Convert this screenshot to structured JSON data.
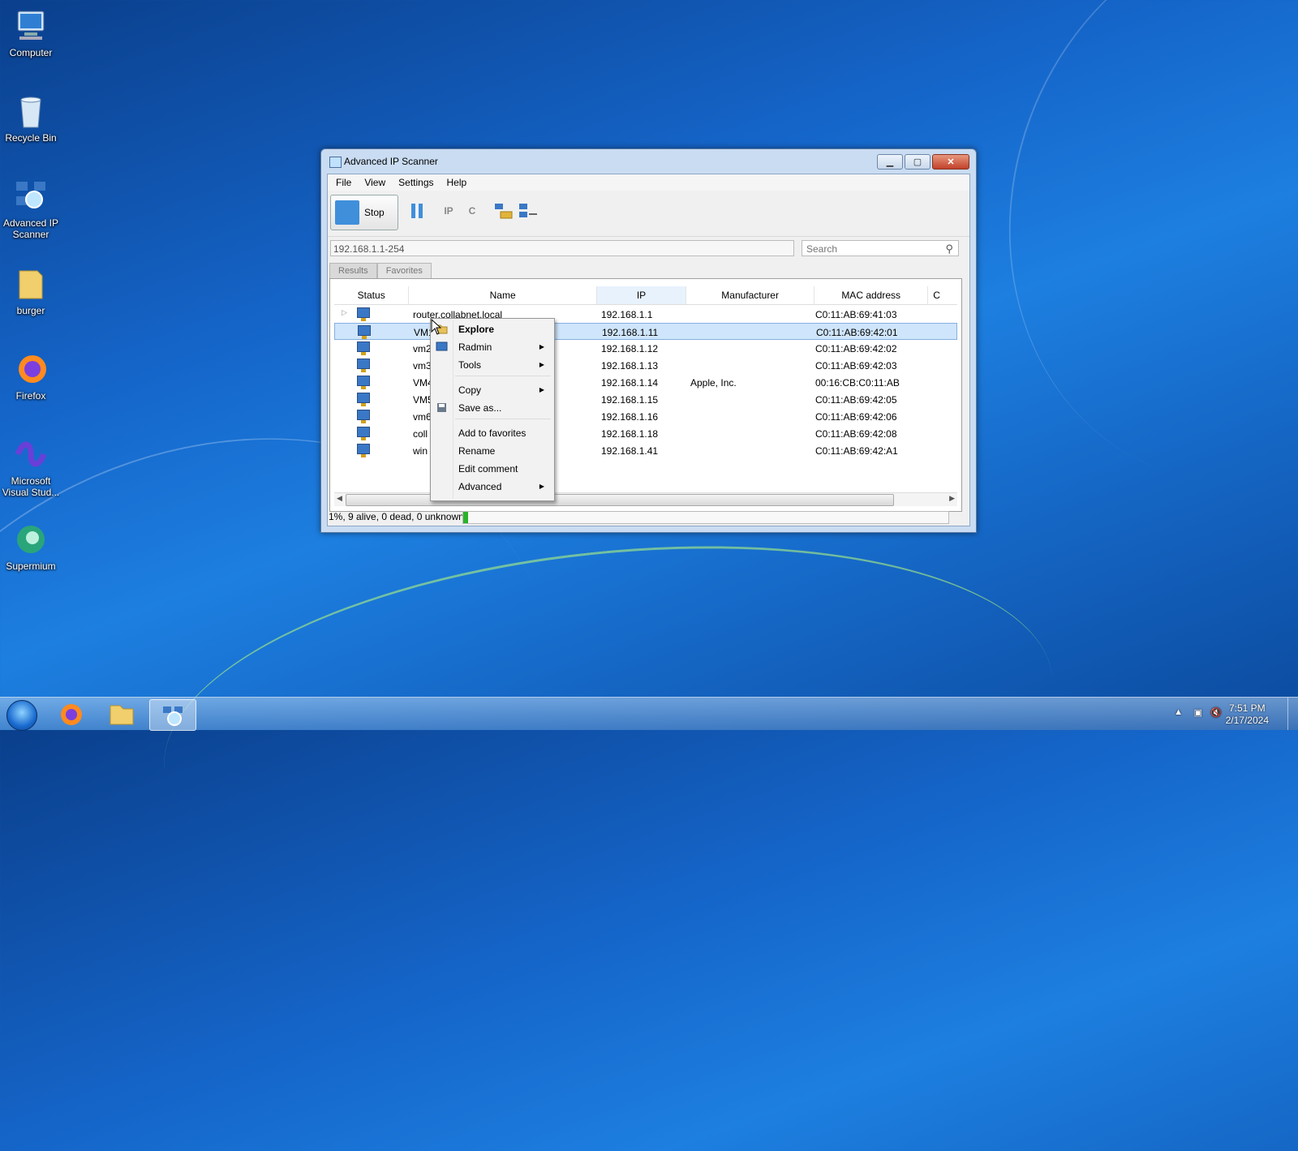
{
  "desktop": {
    "icons": [
      {
        "label": "Computer",
        "icon": "computer-icon"
      },
      {
        "label": "Recycle Bin",
        "icon": "recycle-bin-icon"
      },
      {
        "label": "Advanced IP Scanner",
        "icon": "advanced-ip-scanner-icon"
      },
      {
        "label": "burger",
        "icon": "folder-icon"
      },
      {
        "label": "Firefox",
        "icon": "firefox-icon"
      },
      {
        "label": "Microsoft Visual Stud...",
        "icon": "visual-studio-icon"
      },
      {
        "label": "Supermium",
        "icon": "supermium-icon"
      }
    ]
  },
  "window": {
    "title": "Advanced IP Scanner",
    "menu": [
      "File",
      "View",
      "Settings",
      "Help"
    ],
    "toolbar": {
      "stop_label": "Stop",
      "ip_label": "IP",
      "c_label": "C"
    },
    "ip_range": "192.168.1.1-254",
    "search_placeholder": "Search",
    "tabs": [
      "Results",
      "Favorites"
    ],
    "columns": [
      "Status",
      "Name",
      "IP",
      "Manufacturer",
      "MAC address",
      "C"
    ],
    "rows": [
      {
        "name": "router.collabnet.local",
        "ip": "192.168.1.1",
        "manufacturer": "",
        "mac": "C0:11:AB:69:41:03"
      },
      {
        "name": "VM1",
        "ip": "192.168.1.11",
        "manufacturer": "",
        "mac": "C0:11:AB:69:42:01"
      },
      {
        "name": "vm2",
        "ip": "192.168.1.12",
        "manufacturer": "",
        "mac": "C0:11:AB:69:42:02"
      },
      {
        "name": "vm3",
        "ip": "192.168.1.13",
        "manufacturer": "",
        "mac": "C0:11:AB:69:42:03"
      },
      {
        "name": "VM4",
        "ip": "192.168.1.14",
        "manufacturer": "Apple, Inc.",
        "mac": "00:16:CB:C0:11:AB"
      },
      {
        "name": "VM5",
        "ip": "192.168.1.15",
        "manufacturer": "",
        "mac": "C0:11:AB:69:42:05"
      },
      {
        "name": "vm6",
        "ip": "192.168.1.16",
        "manufacturer": "",
        "mac": "C0:11:AB:69:42:06"
      },
      {
        "name": "coll",
        "ip": "192.168.1.18",
        "manufacturer": "",
        "mac": "C0:11:AB:69:42:08"
      },
      {
        "name": "win",
        "ip": "192.168.1.41",
        "manufacturer": "",
        "mac": "C0:11:AB:69:42:A1"
      }
    ],
    "status_text": "1%, 9 alive, 0 dead, 0 unknown",
    "progress_percent": 1
  },
  "context_menu": {
    "items": [
      {
        "label": "Explore",
        "bold": true,
        "submenu": false
      },
      {
        "label": "Radmin",
        "submenu": true
      },
      {
        "label": "Tools",
        "submenu": true
      },
      {
        "label": "Copy",
        "submenu": true
      },
      {
        "label": "Save as...",
        "submenu": false
      },
      {
        "label": "Add to favorites",
        "submenu": false
      },
      {
        "label": "Rename",
        "submenu": false
      },
      {
        "label": "Edit comment",
        "submenu": false
      },
      {
        "label": "Advanced",
        "submenu": true
      }
    ]
  },
  "taskbar": {
    "time": "7:51 PM",
    "date": "2/17/2024"
  }
}
